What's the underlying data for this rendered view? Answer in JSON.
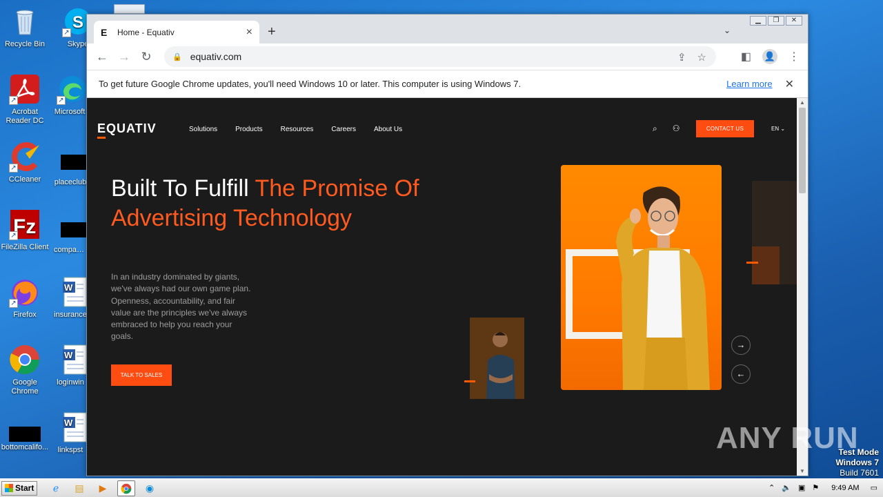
{
  "desktop": {
    "icons": [
      {
        "label": "Recycle Bin"
      },
      {
        "label": "Skype"
      },
      {
        "label": "Acrobat Reader DC"
      },
      {
        "label": "Microsoft"
      },
      {
        "label": "CCleaner"
      },
      {
        "label": "placeclub"
      },
      {
        "label": "FileZilla Client"
      },
      {
        "label": "companys"
      },
      {
        "label": "Firefox"
      },
      {
        "label": "insurance"
      },
      {
        "label": "Google Chrome"
      },
      {
        "label": "loginwin"
      },
      {
        "label": "bottomcalifo..."
      },
      {
        "label": "linkspst"
      }
    ]
  },
  "browser": {
    "tab_title": "Home - Equativ",
    "tab_favicon": "E",
    "url": "equativ.com",
    "infobar_message": "To get future Google Chrome updates, you'll need Windows 10 or later. This computer is using Windows 7.",
    "infobar_link": "Learn more"
  },
  "site": {
    "logo": "EQUATIV",
    "nav": [
      "Solutions",
      "Products",
      "Resources",
      "Careers",
      "About Us"
    ],
    "contact_button": "CONTACT US",
    "language": "EN",
    "headline_white": "Built To Fulfill ",
    "headline_orange": "The Promise Of Advertising Technology",
    "lead": "In an industry dominated by giants, we've always had our own game plan. Openness, accountability, and fair value are the principles we've always embraced to help you reach your goals.",
    "cta_button": "TALK TO SALES",
    "accent_color": "#ff4d12"
  },
  "overlay": {
    "watermark": "ANY RUN",
    "test_mode_1": "Test Mode",
    "test_mode_2": "Windows 7",
    "test_mode_3": "Build 7601"
  },
  "taskbar": {
    "start_label": "Start",
    "clock": "9:49 AM"
  }
}
